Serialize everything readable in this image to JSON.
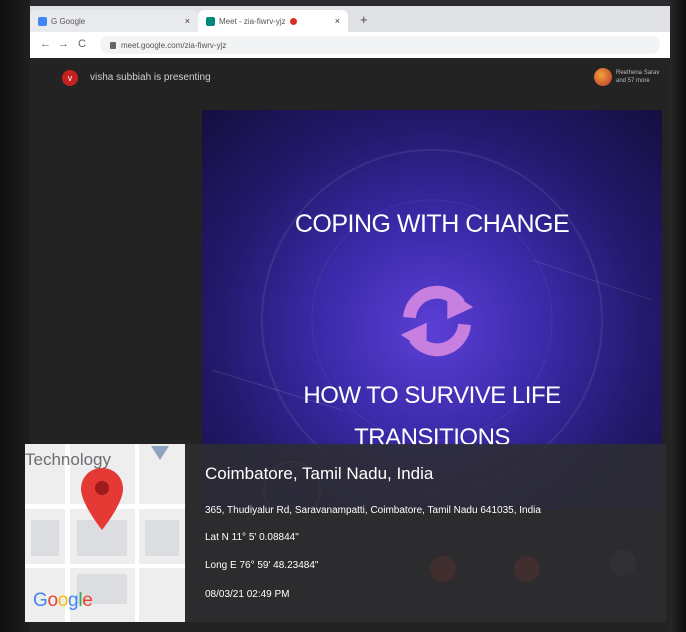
{
  "browser": {
    "tabs": [
      {
        "label": "G Google",
        "active": false
      },
      {
        "label": "Meet - zia-fiwrv-yjz",
        "active": true
      }
    ],
    "new_tab_label": "+",
    "nav": {
      "back": "←",
      "forward": "→",
      "reload": "C"
    },
    "address": "meet.google.com/zia-fiwrv-yjz"
  },
  "meet": {
    "presenter_initial": "v",
    "presenter_text": "visha subbiah is presenting",
    "participants_text": "Reethena Sarav and 57 more"
  },
  "slide": {
    "title": "COPING WITH CHANGE",
    "subtitle_line1": "HOW TO SURVIVE LIFE",
    "subtitle_line2": "TRANSITIONS",
    "icon": "sync-arrows-icon",
    "icon_color": "#c77fe0"
  },
  "geotag": {
    "map_label": "Technology",
    "map_brand": "Google",
    "city": "Coimbatore, Tamil Nadu, India",
    "address": "365, Thudiyalur Rd, Saravanampatti, Coimbatore, Tamil Nadu 641035, India",
    "lat": "Lat N 11° 5' 0.08844\"",
    "long": "Long E 76° 59' 48.23484\"",
    "timestamp": "08/03/21 02:49 PM",
    "pin_color": "#e53935"
  }
}
